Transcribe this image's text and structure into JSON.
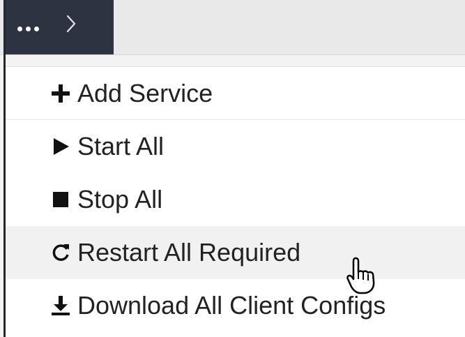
{
  "toolbar": {
    "toggle_icon": "ellipsis-icon",
    "next_icon": "chevron-right-icon",
    "accent_color": "#2d3340"
  },
  "menu": {
    "items": [
      {
        "label": "Add Service",
        "icon": "plus-icon"
      },
      {
        "label": "Start All",
        "icon": "play-icon"
      },
      {
        "label": "Stop All",
        "icon": "stop-icon"
      },
      {
        "label": "Restart All Required",
        "icon": "refresh-icon",
        "hovered": true
      },
      {
        "label": "Download All Client Configs",
        "icon": "download-icon"
      }
    ]
  },
  "cursor": {
    "icon": "hand-pointer-icon"
  }
}
